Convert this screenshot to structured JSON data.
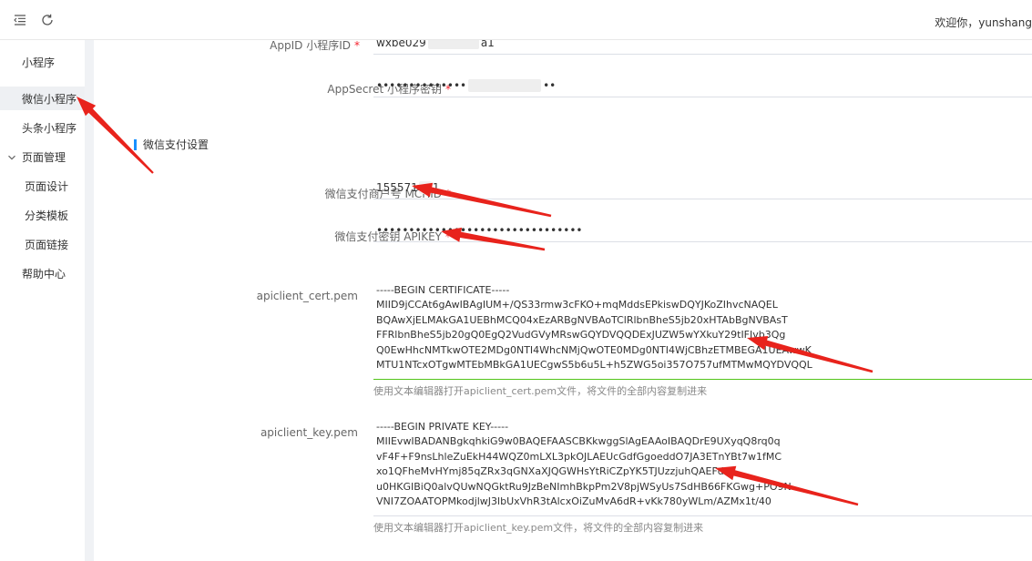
{
  "header": {
    "menu_icon": "menu-fold-icon",
    "refresh_icon": "refresh-icon",
    "welcome": "欢迎你，yunshang"
  },
  "sidebar": {
    "items": [
      {
        "label": "小程序"
      },
      {
        "label": "微信小程序",
        "active": true
      },
      {
        "label": "头条小程序"
      },
      {
        "label": "页面管理",
        "expanded": true,
        "icon": "chevron-down-icon"
      },
      {
        "label": "页面设计"
      },
      {
        "label": "分类模板"
      },
      {
        "label": "页面链接"
      },
      {
        "label": "帮助中心"
      }
    ]
  },
  "form": {
    "appid": {
      "label": "AppID 小程序ID",
      "value_start": "wxbe029",
      "value_end": "a1",
      "required": "*"
    },
    "appsecret": {
      "label": "AppSecret 小程序密钥",
      "value_start": "••••••••••••••",
      "value_end": "••",
      "required": "*"
    },
    "pay_section_title": "微信支付设置",
    "mchid": {
      "label": "微信支付商户号 MCHID",
      "value": "155571",
      "value_end": "1",
      "required": "*"
    },
    "apikey": {
      "label": "微信支付密钥 APIKEY",
      "value": "••••••••••••••••••••••••••••••••",
      "required": "*"
    },
    "cert": {
      "label": "apiclient_cert.pem",
      "lines": [
        "-----BEGIN CERTIFICATE-----",
        "MIID9jCCAt6gAwIBAgIUM+/QS33rmw3cFKO+mqMddsEPkiswDQYJKoZIhvcNAQEL",
        "BQAwXjELMAkGA1UEBhMCQ04xEzARBgNVBAoTClRlbnBheS5jb20xHTAbBgNVBAsT",
        "FFRlbnBheS5jb20gQ0EgQ2VudGVyMRswGQYDVQQDExJUZW5wYXkuY29tIFJvb3Qg",
        "Q0EwHhcNMTkwOTE2MDg0NTI4WhcNMjQwOTE0MDg0NTI4WjCBhzETMBEGA1UEAwwK",
        "MTU1NTcxOTgwMTEbMBkGA1UECgwS5b6u5L+h5ZWG5oi357O757ufMTMwMQYDVQQL"
      ],
      "help": "使用文本编辑器打开apiclient_cert.pem文件，将文件的全部内容复制进来"
    },
    "key": {
      "label": "apiclient_key.pem",
      "lines": [
        "-----BEGIN PRIVATE KEY-----",
        "MIIEvwIBADANBgkqhkiG9w0BAQEFAASCBKkwggSlAgEAAoIBAQDrE9UXyqQ8rq0q",
        "vF4F+F9nsLhleZuEkH44WQZ0mLXL3pkOJLAEUcGdfGgoeddO7JA3ETnYBt7w1fMC",
        "xo1QFheMvHYmj85qZRx3qGNXaXJQGWHsYtRiCZpYK5TJUzzjuhQAEFd",
        "u0HKGIBiQ0alvQUwNQGktRu9JzBeNImhBkpPm2V8pjWSyUs7SdHB66FKGwg+PO9N",
        "VNI7ZOAATOPMkodjlwJ3lbUxVhR3tAlcxOiZuMvA6dR+vKk780yWLm/AZMx1t/40"
      ],
      "help": "使用文本编辑器打开apiclient_key.pem文件，将文件的全部内容复制进来"
    }
  },
  "annotation_color": "#e8231c"
}
